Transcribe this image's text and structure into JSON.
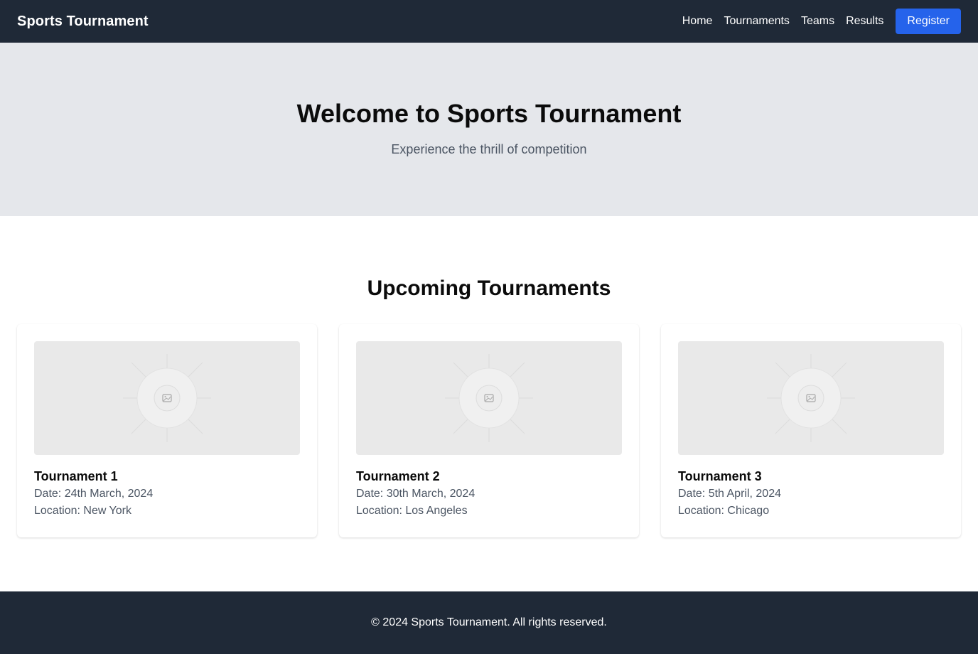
{
  "nav": {
    "brand": "Sports Tournament",
    "links": [
      "Home",
      "Tournaments",
      "Teams",
      "Results"
    ],
    "register_label": "Register"
  },
  "hero": {
    "title": "Welcome to Sports Tournament",
    "subtitle": "Experience the thrill of competition"
  },
  "tournaments": {
    "title": "Upcoming Tournaments",
    "cards": [
      {
        "name": "Tournament 1",
        "date": "Date: 24th March, 2024",
        "location": "Location: New York",
        "image_icon": "image-placeholder-icon"
      },
      {
        "name": "Tournament 2",
        "date": "Date: 30th March, 2024",
        "location": "Location: Los Angeles",
        "image_icon": "image-placeholder-icon"
      },
      {
        "name": "Tournament 3",
        "date": "Date: 5th April, 2024",
        "location": "Location: Chicago",
        "image_icon": "image-placeholder-icon"
      }
    ]
  },
  "footer": {
    "text": "© 2024 Sports Tournament. All rights reserved."
  },
  "colors": {
    "nav_bg": "#1f2937",
    "hero_bg": "#e5e7eb",
    "accent": "#2563eb",
    "muted_text": "#4b5563"
  }
}
